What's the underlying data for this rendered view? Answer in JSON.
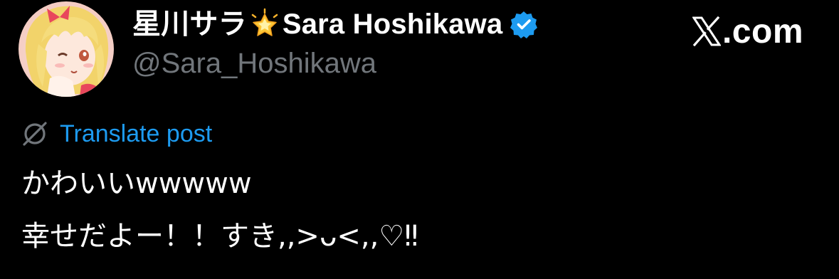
{
  "author": {
    "display_name_jp": "星川サラ",
    "display_name_en": "Sara Hoshikawa",
    "handle": "@Sara_Hoshikawa",
    "name_emoji_icon": "glowing-star-icon",
    "verified_icon": "verified-badge-icon"
  },
  "brand": {
    "site_label": ".com",
    "logo_icon": "x-logo-icon"
  },
  "translate": {
    "icon": "globe-off-icon",
    "label": "Translate post"
  },
  "post": {
    "lines": [
      "かわいいwwwww",
      "幸せだよー！！すき,,>ᴗ<,,♡‼︎"
    ]
  },
  "colors": {
    "background": "#000000",
    "text": "#ffffff",
    "muted": "#71767b",
    "link": "#1d9bf0",
    "verified": "#1d9bf0"
  }
}
